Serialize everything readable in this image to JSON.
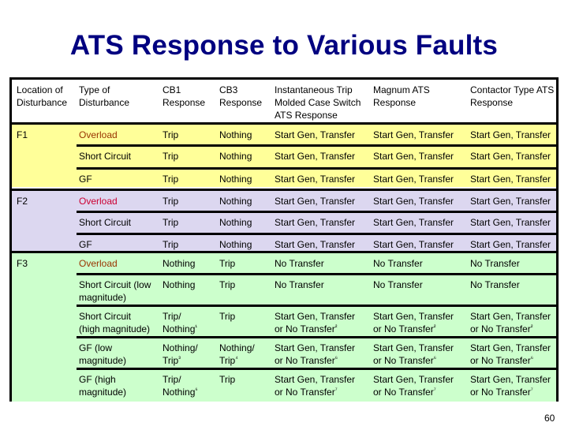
{
  "slide": {
    "title": "ATS Response to Various Faults",
    "page_number": "60"
  },
  "table": {
    "headers": [
      [
        "Location of",
        "Disturbance"
      ],
      [
        "Type of",
        "Disturbance"
      ],
      [
        "CB1",
        "Response"
      ],
      [
        "CB3",
        "Response"
      ],
      [
        "Instantaneous Trip",
        "Molded Case Switch",
        "ATS Response"
      ],
      [
        "Magnum ATS",
        "Response"
      ],
      [
        "Contactor Type ATS",
        "Response"
      ]
    ],
    "groups": [
      {
        "location": "F1",
        "color": "#ffff99",
        "rows": [
          {
            "type": [
              "Overload"
            ],
            "cb1": [
              "Trip"
            ],
            "cb3": [
              "Nothing"
            ],
            "inst": [
              "Start Gen, Transfer"
            ],
            "magnum": [
              "Start Gen, Transfer"
            ],
            "contactor": [
              "Start Gen, Transfer"
            ]
          },
          {
            "type": [
              "Short Circuit"
            ],
            "cb1": [
              "Trip"
            ],
            "cb3": [
              "Nothing"
            ],
            "inst": [
              "Start Gen, Transfer"
            ],
            "magnum": [
              "Start Gen, Transfer"
            ],
            "contactor": [
              "Start Gen, Transfer"
            ]
          },
          {
            "type": [
              "GF"
            ],
            "cb1": [
              "Trip"
            ],
            "cb3": [
              "Nothing"
            ],
            "inst": [
              "Start Gen, Transfer"
            ],
            "magnum": [
              "Start Gen, Transfer"
            ],
            "contactor": [
              "Start Gen, Transfer"
            ]
          }
        ]
      },
      {
        "location": "F2",
        "color": "#dcd7f0",
        "rows": [
          {
            "type": [
              "Overload"
            ],
            "cb1": [
              "Trip"
            ],
            "cb3": [
              "Nothing"
            ],
            "inst": [
              "Start Gen, Transfer"
            ],
            "magnum": [
              "Start Gen, Transfer"
            ],
            "contactor": [
              "Start Gen, Transfer"
            ]
          },
          {
            "type": [
              "Short Circuit"
            ],
            "cb1": [
              "Trip"
            ],
            "cb3": [
              "Nothing"
            ],
            "inst": [
              "Start Gen, Transfer"
            ],
            "magnum": [
              "Start Gen, Transfer"
            ],
            "contactor": [
              "Start Gen, Transfer"
            ]
          },
          {
            "type": [
              "GF"
            ],
            "cb1": [
              "Trip"
            ],
            "cb3": [
              "Nothing"
            ],
            "inst": [
              "Start Gen, Transfer"
            ],
            "magnum": [
              "Start Gen, Transfer"
            ],
            "contactor": [
              "Start Gen, Transfer"
            ]
          }
        ]
      },
      {
        "location": "F3",
        "color": "#ccffcc",
        "rows": [
          {
            "type": [
              "Overload"
            ],
            "cb1": [
              "Nothing"
            ],
            "cb3": [
              "Trip"
            ],
            "inst": [
              "No Transfer"
            ],
            "magnum": [
              "No Transfer"
            ],
            "contactor": [
              "No Transfer"
            ]
          },
          {
            "type": [
              "Short Circuit (low",
              "magnitude)"
            ],
            "cb1": [
              "Nothing"
            ],
            "cb3": [
              "Trip"
            ],
            "inst": [
              "No Transfer"
            ],
            "magnum": [
              "No Transfer"
            ],
            "contactor": [
              "No Transfer"
            ]
          },
          {
            "type": [
              "Short Circuit",
              "(high magnitude)"
            ],
            "cb1": [
              "Trip/",
              "Nothing¹"
            ],
            "cb3": [
              "Trip"
            ],
            "inst": [
              "Start Gen, Transfer",
              "or No Transfer²"
            ],
            "magnum": [
              "Start Gen, Transfer",
              "or No Transfer²"
            ],
            "contactor": [
              "Start Gen, Transfer",
              "or No Transfer²"
            ]
          },
          {
            "type": [
              "GF (low",
              "magnitude)"
            ],
            "cb1": [
              "Nothing/",
              "Trip³"
            ],
            "cb3": [
              "Nothing/",
              "Trip⁴"
            ],
            "inst": [
              "Start Gen, Transfer",
              "or No Transfer⁶"
            ],
            "magnum": [
              "Start Gen, Transfer",
              "or No Transfer⁶"
            ],
            "contactor": [
              "Start Gen, Transfer",
              "or No Transfer⁶"
            ]
          },
          {
            "type": [
              "GF (high",
              "magnitude)"
            ],
            "cb1": [
              "Trip/",
              "Nothing⁶"
            ],
            "cb3": [
              "Trip"
            ],
            "inst": [
              "Start Gen, Transfer",
              "or No Transfer⁷"
            ],
            "magnum": [
              "Start Gen, Transfer",
              "or No Transfer⁷"
            ],
            "contactor": [
              "Start Gen, Transfer",
              "or No Transfer⁷"
            ]
          }
        ]
      }
    ],
    "colors": {
      "title": "#000080",
      "overload_f1": "#993300",
      "overload_f2": "#cc0033",
      "overload_f3": "#993300"
    }
  }
}
